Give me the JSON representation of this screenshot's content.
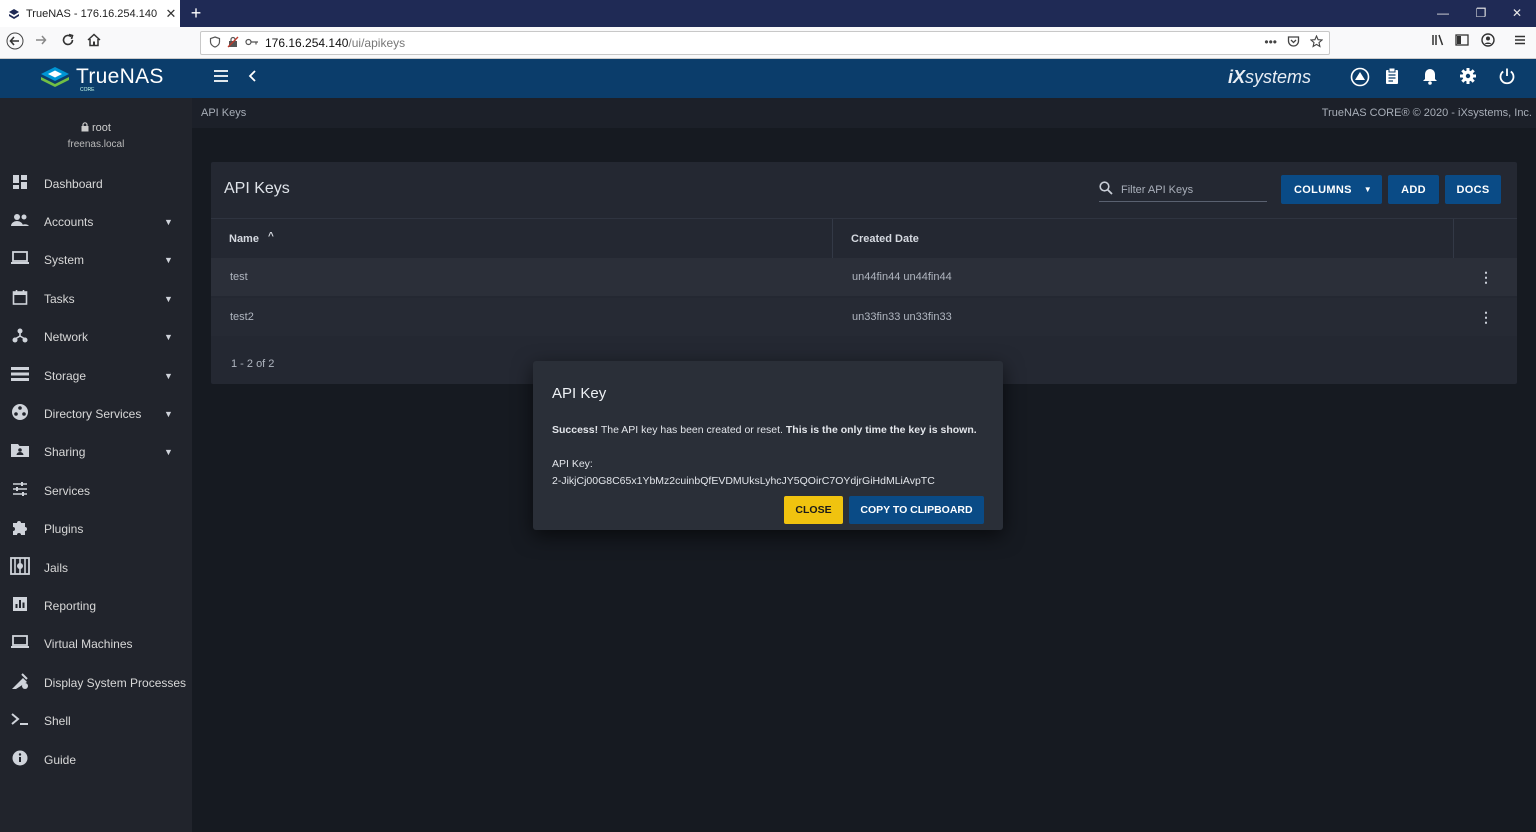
{
  "browser": {
    "tab_title": "TrueNAS - 176.16.254.140",
    "tab_close": "✕",
    "new_tab": "+",
    "url_host": "176.16.254.140",
    "url_path": "/ui/apikeys",
    "url_more": "•••",
    "window_controls": [
      "—",
      "❐",
      "✕"
    ]
  },
  "header": {
    "logo_text": "TrueNAS",
    "logo_sub": "CORE",
    "vendor_text_prefix": "iX",
    "vendor_text": "systems"
  },
  "sidebar": {
    "user": "root",
    "host": "freenas.local",
    "items": [
      {
        "label": "Dashboard",
        "icon": "dashboard-icon",
        "caret": false
      },
      {
        "label": "Accounts",
        "icon": "accounts-icon",
        "caret": true
      },
      {
        "label": "System",
        "icon": "system-icon",
        "caret": true
      },
      {
        "label": "Tasks",
        "icon": "tasks-icon",
        "caret": true
      },
      {
        "label": "Network",
        "icon": "network-icon",
        "caret": true
      },
      {
        "label": "Storage",
        "icon": "storage-icon",
        "caret": true
      },
      {
        "label": "Directory Services",
        "icon": "directory-services-icon",
        "caret": true
      },
      {
        "label": "Sharing",
        "icon": "sharing-icon",
        "caret": true
      },
      {
        "label": "Services",
        "icon": "services-icon",
        "caret": false
      },
      {
        "label": "Plugins",
        "icon": "plugins-icon",
        "caret": false
      },
      {
        "label": "Jails",
        "icon": "jails-icon",
        "caret": false
      },
      {
        "label": "Reporting",
        "icon": "reporting-icon",
        "caret": false
      },
      {
        "label": "Virtual Machines",
        "icon": "virtual-machines-icon",
        "caret": false
      },
      {
        "label": "Display System Processes",
        "icon": "processes-icon",
        "caret": false
      },
      {
        "label": "Shell",
        "icon": "shell-icon",
        "caret": false
      },
      {
        "label": "Guide",
        "icon": "guide-icon",
        "caret": false
      }
    ]
  },
  "breadcrumb": "API Keys",
  "copyright": "TrueNAS CORE® © 2020 - iXsystems, Inc.",
  "card": {
    "title": "API Keys",
    "filter_placeholder": "Filter API Keys",
    "columns_label": "COLUMNS",
    "add_label": "ADD",
    "docs_label": "DOCS",
    "headers": [
      "Name",
      "Created Date"
    ],
    "sort_indicator": "^",
    "rows": [
      {
        "name": "test",
        "created": "un44fin44 un44fin44"
      },
      {
        "name": "test2",
        "created": "un33fin33 un33fin33"
      }
    ],
    "paginator": "1 - 2 of 2"
  },
  "dialog": {
    "title": "API Key",
    "success": "Success!",
    "message": " The API key has been created or reset. ",
    "warning": "This is the only time the key is shown.",
    "key_label": "API Key:",
    "key_value": "2-JikjCj00G8C65x1YbMz2cuinbQfEVDMUksLyhcJY5QOirC7OYdjrGiHdMLiAvpTC",
    "close_label": "CLOSE",
    "copy_label": "COPY TO CLIPBOARD"
  }
}
